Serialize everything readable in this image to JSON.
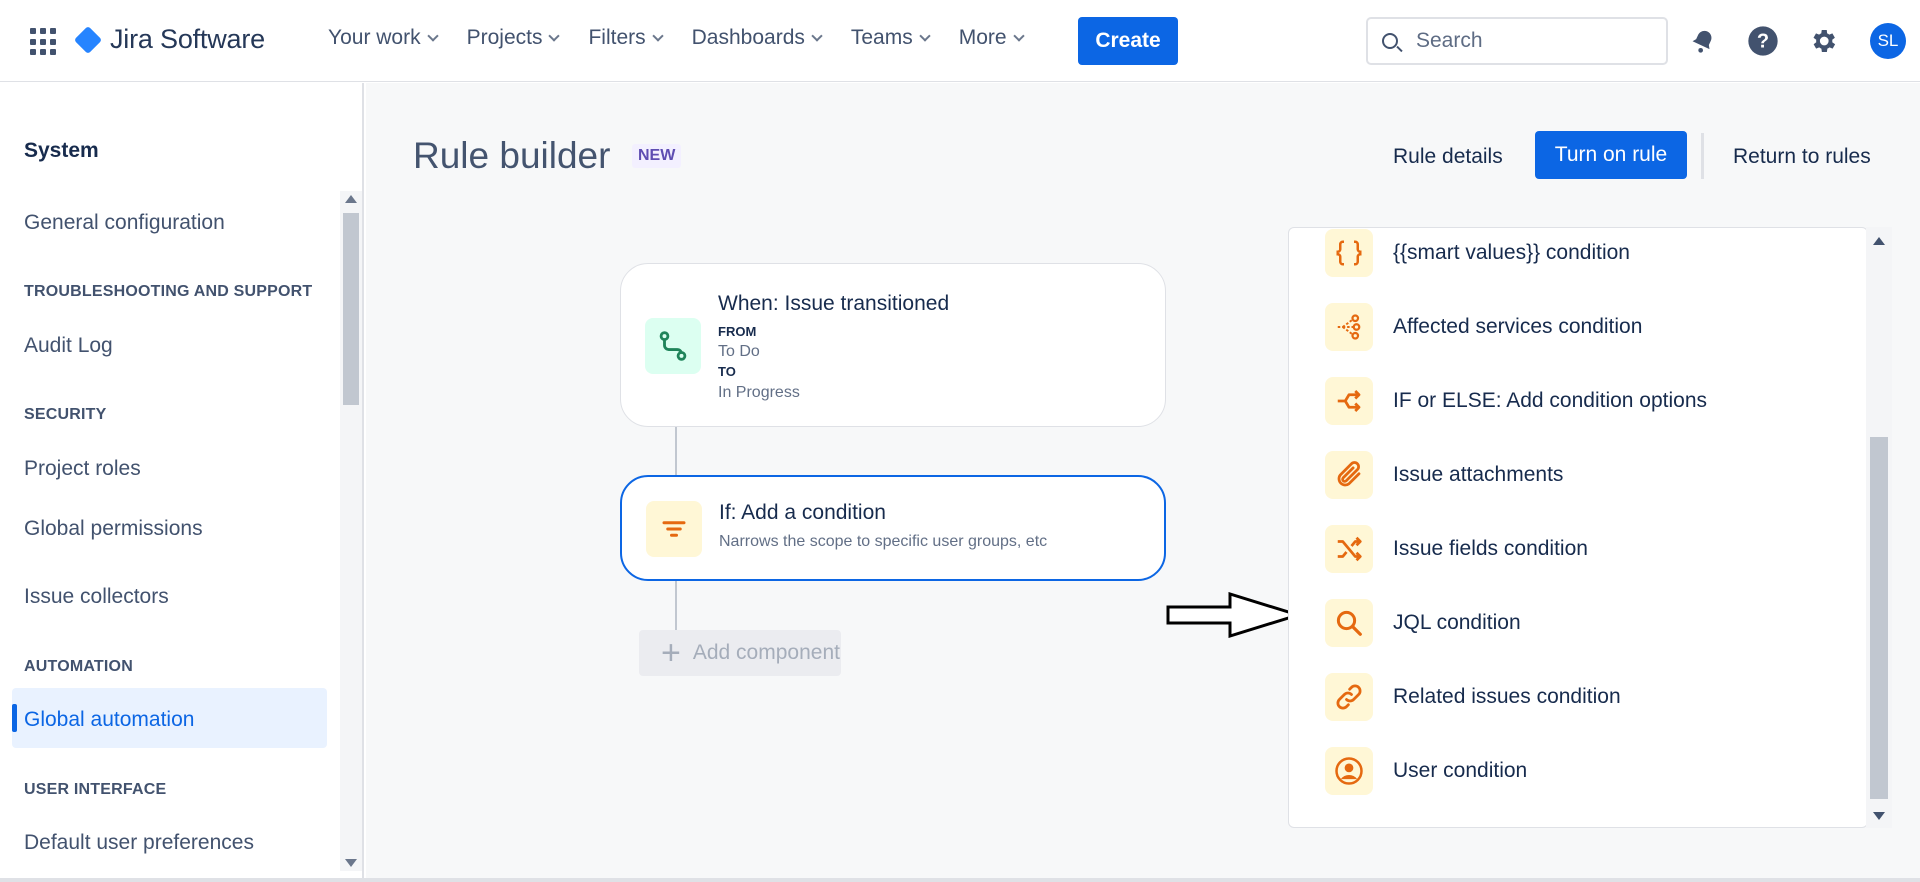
{
  "app": {
    "name": "Jira Software"
  },
  "nav": {
    "items": [
      "Your work",
      "Projects",
      "Filters",
      "Dashboards",
      "Teams",
      "More"
    ],
    "create_label": "Create",
    "search_placeholder": "Search",
    "avatar_initials": "SL"
  },
  "sidebar": {
    "title": "System",
    "general_configuration": "General configuration",
    "troubleshooting_header": "TROUBLESHOOTING AND SUPPORT",
    "audit_log": "Audit Log",
    "security_header": "SECURITY",
    "project_roles": "Project roles",
    "global_permissions": "Global permissions",
    "issue_collectors": "Issue collectors",
    "automation_header": "AUTOMATION",
    "global_automation": "Global automation",
    "user_interface_header": "USER INTERFACE",
    "default_user_preferences": "Default user preferences"
  },
  "main": {
    "title": "Rule builder",
    "badge": "NEW",
    "rule_details": "Rule details",
    "turn_on_rule": "Turn on rule",
    "return_to_rules": "Return to rules"
  },
  "trigger": {
    "title": "When: Issue transitioned",
    "from_label": "FROM",
    "from_value": "To Do",
    "to_label": "TO",
    "to_value": "In Progress"
  },
  "condition": {
    "title": "If: Add a condition",
    "subtitle": "Narrows the scope to specific user groups, etc"
  },
  "add_component": "Add component",
  "condition_options": [
    {
      "label": "{{smart values}} condition",
      "icon": "braces-icon"
    },
    {
      "label": "Affected services condition",
      "icon": "services-icon"
    },
    {
      "label": "IF or ELSE: Add condition options",
      "icon": "branch-icon"
    },
    {
      "label": "Issue attachments",
      "icon": "paperclip-icon"
    },
    {
      "label": "Issue fields condition",
      "icon": "shuffle-icon"
    },
    {
      "label": "JQL condition",
      "icon": "search-icon"
    },
    {
      "label": "Related issues condition",
      "icon": "link-icon"
    },
    {
      "label": "User condition",
      "icon": "user-icon"
    }
  ],
  "colors": {
    "brand": "#0C66E4",
    "condition_icon": "#E56910",
    "trigger_icon": "#1F845A"
  }
}
